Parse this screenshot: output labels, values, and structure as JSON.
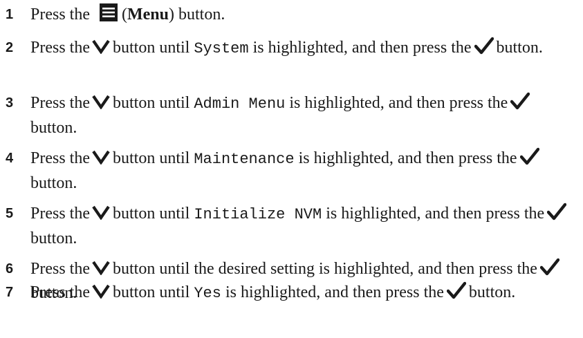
{
  "steps": [
    {
      "number": "1",
      "pre": "Press the",
      "button_name": "Menu",
      "post": "button."
    },
    {
      "number": "2",
      "pre": "Press the",
      "mid": "button until",
      "item": "System",
      "post": "is highlighted, and then press the",
      "end": "button."
    },
    {
      "number": "3",
      "pre": "Press the",
      "mid": "button until",
      "item": "Admin Menu",
      "post": "is highlighted, and then press the",
      "end": "button."
    },
    {
      "number": "4",
      "pre": "Press the",
      "mid": "button until",
      "item": "Maintenance",
      "post": "is highlighted, and then press the",
      "end": "button."
    },
    {
      "number": "5",
      "pre": "Press the",
      "mid": "button until",
      "item": "Initialize NVM",
      "post": "is highlighted, and then press the",
      "end": "button."
    },
    {
      "number": "6",
      "pre": "Press the",
      "mid": "button until the desired setting is highlighted, and then press the",
      "end": "button."
    },
    {
      "number": "7",
      "pre": "Press the",
      "mid": "button until",
      "item": "Yes",
      "post": "is highlighted, and then press the",
      "end": "button."
    }
  ],
  "icons": {
    "menu": "menu-icon",
    "down": "down-arrow-icon",
    "select": "checkmark-icon"
  }
}
